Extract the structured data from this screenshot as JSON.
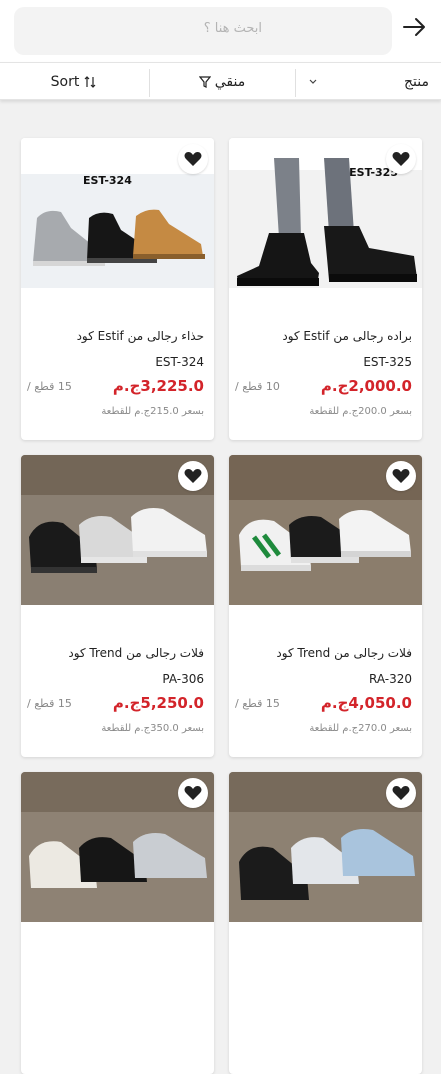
{
  "search": {
    "placeholder": "ابحث هنا ؟"
  },
  "filters": {
    "sort_label": "Sort",
    "filter_label": "منقي",
    "product_label": "منتج"
  },
  "products": [
    {
      "name": "براده رجالى من Estif كود",
      "code": "EST-325",
      "price": "2,000.0ج.م",
      "qty": "10 قطع /",
      "unit_price": "بسعر 200.0ج.م للقطعة",
      "badge": "EST-325"
    },
    {
      "name": "حذاء رجالى من Estif كود",
      "code": "EST-324",
      "price": "3,225.0ج.م",
      "qty": "15 قطع /",
      "unit_price": "بسعر 215.0ج.م للقطعة",
      "badge": "EST-324"
    },
    {
      "name": "فلات رجالى من Trend كود",
      "code": "RA-320",
      "price": "4,050.0ج.م",
      "qty": "15 قطع /",
      "unit_price": "بسعر 270.0ج.م للقطعة"
    },
    {
      "name": "فلات رجالى من Trend كود",
      "code": "PA-306",
      "price": "5,250.0ج.م",
      "qty": "15 قطع /",
      "unit_price": "بسعر 350.0ج.م للقطعة"
    },
    {},
    {}
  ]
}
